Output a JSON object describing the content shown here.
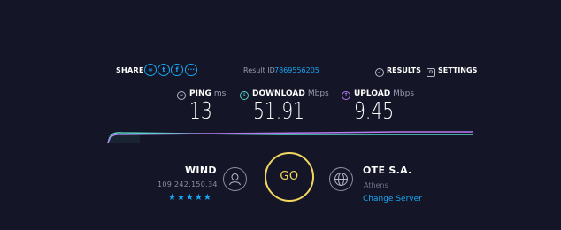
{
  "share": {
    "label": "SHARE",
    "icons": [
      "link-icon",
      "twitter-icon",
      "facebook-icon",
      "more-icon"
    ]
  },
  "result": {
    "label": "Result ID",
    "id": "7869556205"
  },
  "nav": {
    "results_label": "RESULTS",
    "settings_label": "SETTINGS"
  },
  "metrics": {
    "ping": {
      "label": "PING",
      "unit": "ms",
      "value": "13"
    },
    "download": {
      "label": "DOWNLOAD",
      "unit": "Mbps",
      "value": "51.91"
    },
    "upload": {
      "label": "UPLOAD",
      "unit": "Mbps",
      "value": "9.45"
    }
  },
  "isp": {
    "name": "WIND",
    "ip": "109.242.150.34",
    "rating": "★★★★★"
  },
  "go": {
    "label": "GO"
  },
  "server": {
    "name": "OTE S.A.",
    "location": "Athens",
    "change_label": "Change Server"
  },
  "colors": {
    "background": "#141526",
    "accent_blue": "#1aa6f2",
    "download_line": "#56d6c8",
    "upload_line": "#b77bf0",
    "go_ring": "#f2d660"
  }
}
